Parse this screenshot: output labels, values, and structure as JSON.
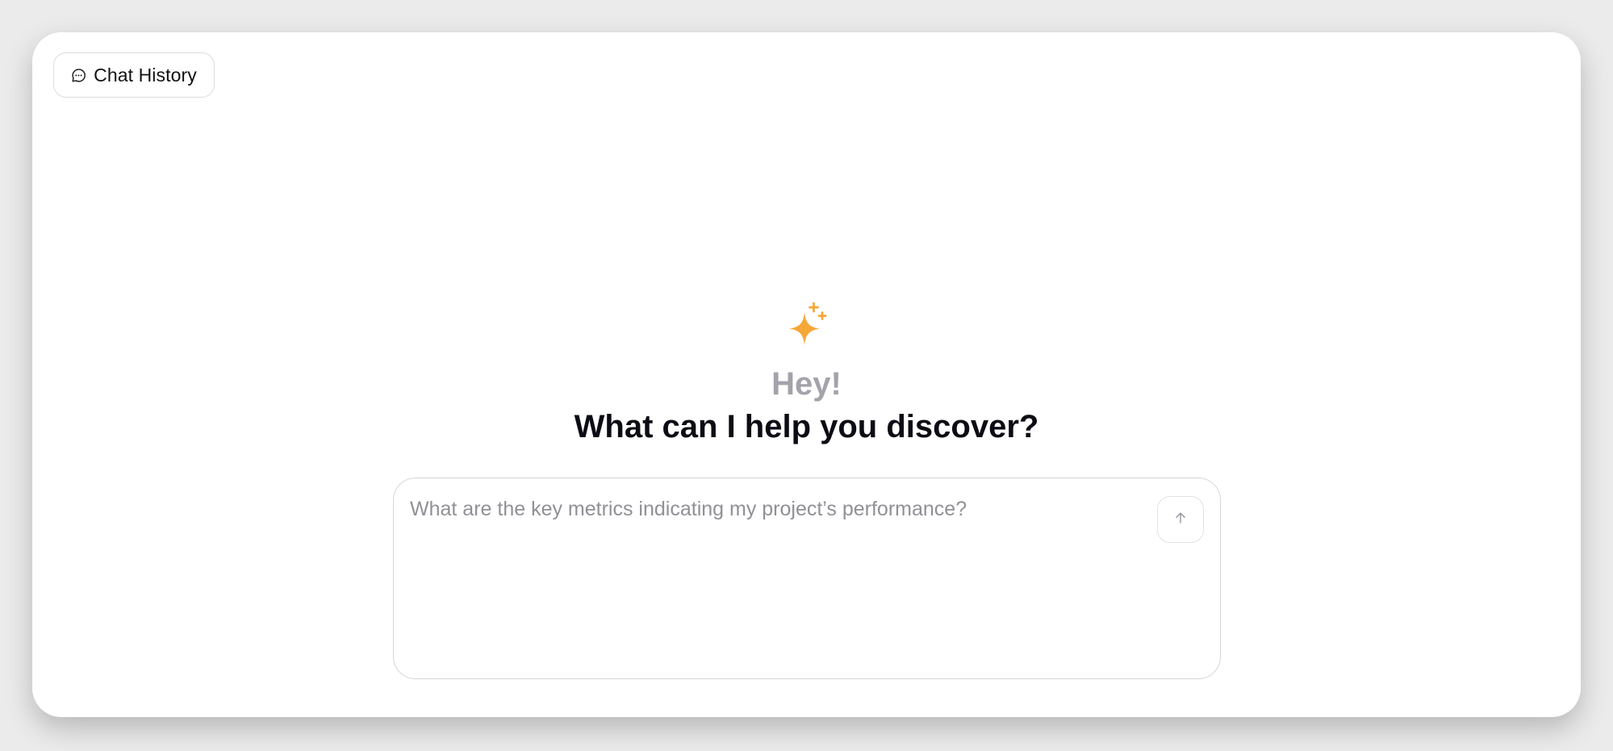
{
  "header": {
    "history_button_label": "Chat History",
    "history_icon": "chat-bubble-icon"
  },
  "hero": {
    "icon": "sparkle-icon",
    "greeting": "Hey!",
    "headline": "What can I help you discover?"
  },
  "composer": {
    "value": "",
    "placeholder": "What are the key metrics indicating my project’s performance?",
    "send_icon": "arrow-up-icon"
  },
  "colors": {
    "accent": "#F5A737",
    "greeting": "#A3A3AB",
    "headline": "#0C0C14"
  }
}
